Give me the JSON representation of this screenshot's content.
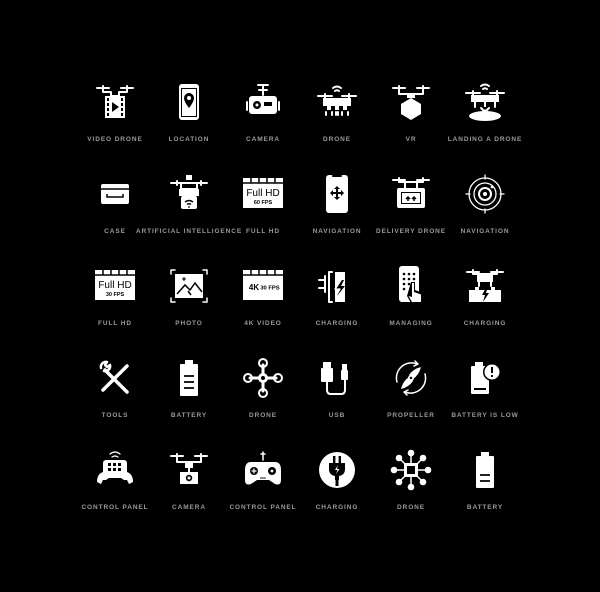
{
  "colors": {
    "background": "#000000",
    "icon": "#ffffff",
    "label": "#9a9a9a"
  },
  "icons": [
    [
      {
        "icon": "video-drone-icon",
        "label": "VIDEO DRONE"
      },
      {
        "icon": "location-icon",
        "label": "LOCATION"
      },
      {
        "icon": "camera-icon",
        "label": "CAMERA"
      },
      {
        "icon": "drone-icon",
        "label": "DRONE"
      },
      {
        "icon": "vr-icon",
        "label": "VR"
      },
      {
        "icon": "landing-drone-icon",
        "label": "LANDING A DRONE"
      }
    ],
    [
      {
        "icon": "case-icon",
        "label": "CASE"
      },
      {
        "icon": "ai-drone-icon",
        "label": "ARTIFICIAL INTELLIGENCE"
      },
      {
        "icon": "full-hd-60-icon",
        "label": "FULL HD",
        "text1": "Full HD",
        "text2": "60 FPS"
      },
      {
        "icon": "phone-navigation-icon",
        "label": "NAVIGATION"
      },
      {
        "icon": "delivery-drone-icon",
        "label": "DELIVERY DRONE"
      },
      {
        "icon": "radar-navigation-icon",
        "label": "NAVIGATION"
      }
    ],
    [
      {
        "icon": "full-hd-30-icon",
        "label": "FULL HD",
        "text1": "Full HD",
        "text2": "30 FPS"
      },
      {
        "icon": "photo-icon",
        "label": "PHOTO"
      },
      {
        "icon": "4k-video-icon",
        "label": "4K VIDEO",
        "text1": "4K",
        "text2": "30 FPS"
      },
      {
        "icon": "plug-charging-icon",
        "label": "CHARGING"
      },
      {
        "icon": "managing-icon",
        "label": "MANAGING"
      },
      {
        "icon": "drone-charging-icon",
        "label": "CHARGING"
      }
    ],
    [
      {
        "icon": "tools-icon",
        "label": "TOOLS"
      },
      {
        "icon": "battery-icon",
        "label": "BATTERY"
      },
      {
        "icon": "quadcopter-icon",
        "label": "DRONE"
      },
      {
        "icon": "usb-icon",
        "label": "USB"
      },
      {
        "icon": "propeller-icon",
        "label": "PROPELLER"
      },
      {
        "icon": "battery-low-icon",
        "label": "BATTERY IS LOW"
      }
    ],
    [
      {
        "icon": "control-panel-hands-icon",
        "label": "CONTROL PANEL"
      },
      {
        "icon": "camera-drone-icon",
        "label": "CAMERA"
      },
      {
        "icon": "gamepad-icon",
        "label": "CONTROL PANEL"
      },
      {
        "icon": "charging-plug-circle-icon",
        "label": "CHARGING"
      },
      {
        "icon": "octocopter-icon",
        "label": "DRONE"
      },
      {
        "icon": "battery-half-icon",
        "label": "BATTERY"
      }
    ]
  ]
}
